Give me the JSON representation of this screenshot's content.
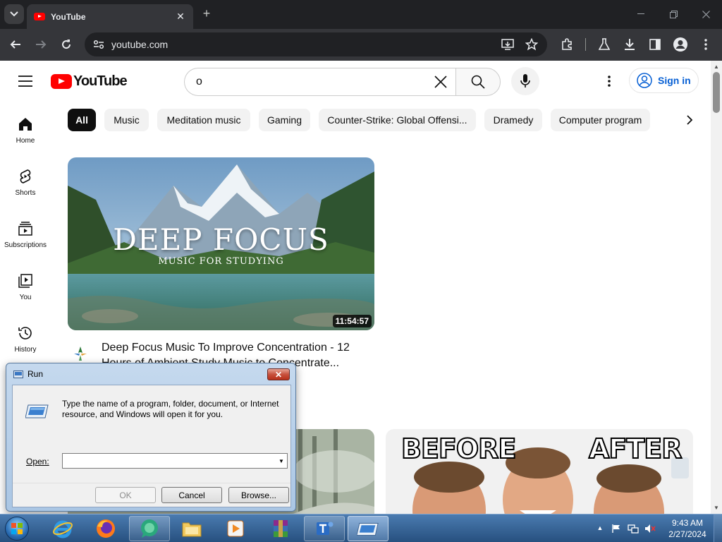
{
  "browser": {
    "tab_title": "YouTube",
    "url": "youtube.com"
  },
  "youtube": {
    "logo_text": "YouTube",
    "search_query": "o",
    "signin_label": "Sign in",
    "guide": [
      {
        "label": "Home",
        "icon": "home-icon"
      },
      {
        "label": "Shorts",
        "icon": "shorts-icon"
      },
      {
        "label": "Subscriptions",
        "icon": "subscriptions-icon"
      },
      {
        "label": "You",
        "icon": "you-icon"
      },
      {
        "label": "History",
        "icon": "history-icon"
      }
    ],
    "chips": [
      "All",
      "Music",
      "Meditation music",
      "Gaming",
      "Counter-Strike: Global Offensi...",
      "Dramedy",
      "Computer program"
    ],
    "video1": {
      "thumb_title": "DEEP FOCUS",
      "thumb_subtitle": "MUSIC FOR STUDYING",
      "duration": "11:54:57",
      "title": "Deep Focus Music To Improve Concentration - 12 Hours of Ambient Study Music to Concentrate..."
    },
    "video3": {
      "thumb_left_word": "BEFORE",
      "thumb_right_word": "AFTER"
    }
  },
  "run_dialog": {
    "title": "Run",
    "description": "Type the name of a program, folder, document, or Internet resource, and Windows will open it for you.",
    "open_label": "Open:",
    "open_value": "",
    "ok_label": "OK",
    "cancel_label": "Cancel",
    "browse_label": "Browse..."
  },
  "taskbar": {
    "time": "9:43 AM",
    "date": "2/27/2024"
  }
}
